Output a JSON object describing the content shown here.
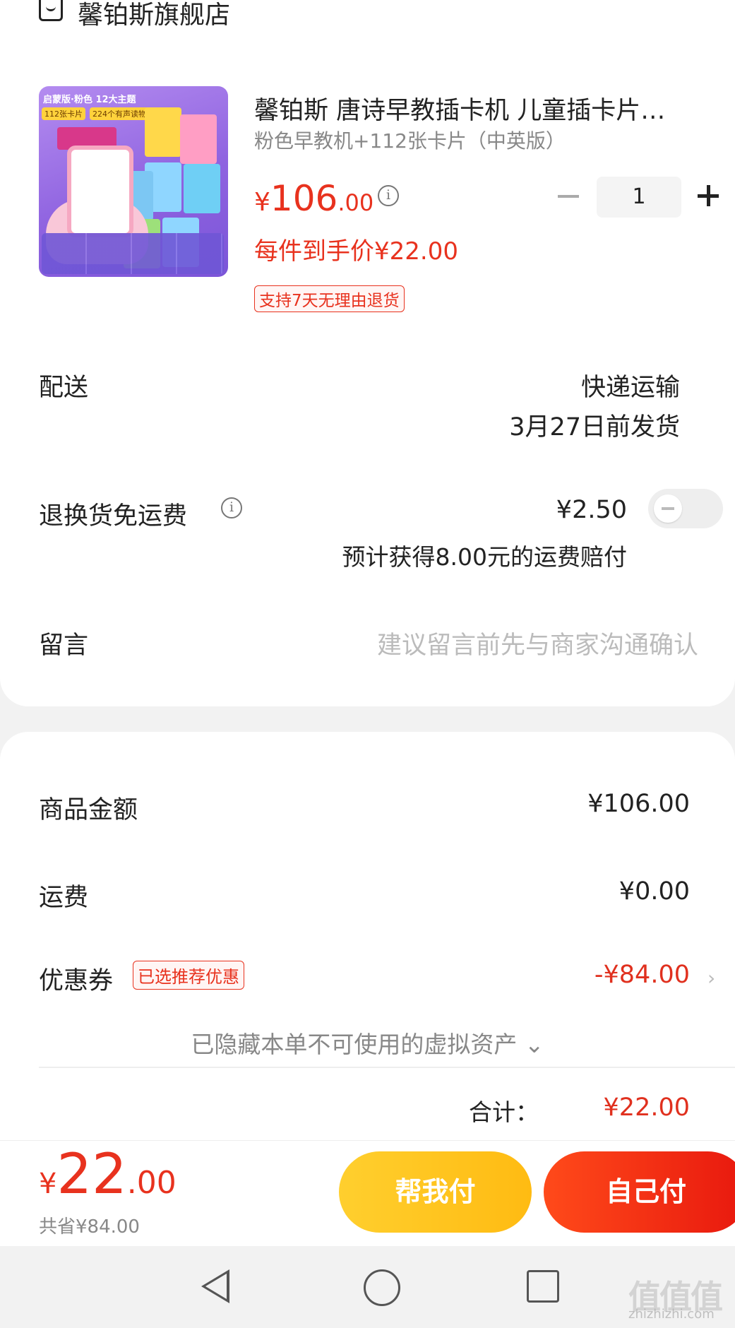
{
  "shop": {
    "name": "馨铂斯旗舰店",
    "icon": "shop-icon"
  },
  "product": {
    "title": "馨铂斯 唐诗早教插卡机 儿童插卡片…",
    "spec": "粉色早教机+112张卡片（中英版）",
    "price_symbol": "¥",
    "price_int": "106",
    "price_dec": ".00",
    "quantity": "1",
    "unit_price_label": "每件到手价¥22.00",
    "return_tag": "支持7天无理由退货",
    "image_text": {
      "banner": "启蒙版·粉色  12大主题",
      "tag1": "112张卡片",
      "tag2": "224个有声读物"
    }
  },
  "delivery": {
    "label": "配送",
    "method": "快递运输",
    "date": "3月27日前发货"
  },
  "return_shipping": {
    "label": "退换货免运费",
    "price": "¥2.50",
    "note": "预计获得8.00元的运费赔付",
    "enabled": false
  },
  "message": {
    "label": "留言",
    "placeholder": "建议留言前先与商家沟通确认"
  },
  "summary": {
    "goods_label": "商品金额",
    "goods_value": "¥106.00",
    "shipping_label": "运费",
    "shipping_value": "¥0.00",
    "coupon_label": "优惠券",
    "coupon_tag": "已选推荐优惠",
    "coupon_value": "-¥84.00",
    "hidden_assets": "已隐藏本单不可使用的虚拟资产 ⌄",
    "total_label": "合计：",
    "total_value": "¥22.00"
  },
  "bottom": {
    "price_symbol": "¥",
    "price_int": "22",
    "price_dec": ".00",
    "saved": "共省¥84.00",
    "help_pay": "帮我付",
    "self_pay": "自己付"
  },
  "watermark": {
    "main": "值值值",
    "sub": "zhizhizhi.com"
  },
  "colors": {
    "accent_red": "#e8321e",
    "yellow_button": "#ffc21e",
    "red_button": "#f0281a"
  }
}
